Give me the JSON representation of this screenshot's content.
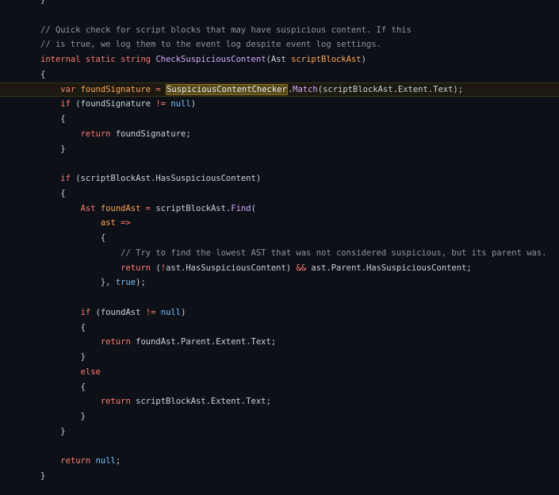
{
  "editor": {
    "lines": [
      [
        {
          "t": "}",
          "k": "plain"
        }
      ],
      [],
      [
        {
          "t": "// Quick check for script blocks that may have suspicious content. If this",
          "k": "cmt"
        }
      ],
      [
        {
          "t": "// is true, we log them to the event log despite event log settings.",
          "k": "cmt"
        }
      ],
      [
        {
          "t": "internal",
          "k": "kw"
        },
        {
          "t": " ",
          "k": "plain"
        },
        {
          "t": "static",
          "k": "kw"
        },
        {
          "t": " ",
          "k": "plain"
        },
        {
          "t": "string",
          "k": "kw"
        },
        {
          "t": " ",
          "k": "plain"
        },
        {
          "t": "CheckSuspiciousContent",
          "k": "fn"
        },
        {
          "t": "(Ast ",
          "k": "plain"
        },
        {
          "t": "scriptBlockAst",
          "k": "var"
        },
        {
          "t": ")",
          "k": "plain"
        }
      ],
      [
        {
          "t": "{",
          "k": "plain"
        }
      ],
      [
        {
          "t": "    ",
          "k": "plain"
        },
        {
          "t": "var",
          "k": "kw"
        },
        {
          "t": " ",
          "k": "plain"
        },
        {
          "t": "foundSignature",
          "k": "var"
        },
        {
          "t": " ",
          "k": "plain"
        },
        {
          "t": "=",
          "k": "op"
        },
        {
          "t": " ",
          "k": "plain"
        },
        {
          "t": "SuspiciousContentChecker",
          "k": "mark"
        },
        {
          "t": ".",
          "k": "plain"
        },
        {
          "t": "Match",
          "k": "fn"
        },
        {
          "t": "(scriptBlockAst.Extent.Text);",
          "k": "plain"
        }
      ],
      [
        {
          "t": "    ",
          "k": "plain"
        },
        {
          "t": "if",
          "k": "kw"
        },
        {
          "t": " (foundSignature ",
          "k": "plain"
        },
        {
          "t": "!=",
          "k": "op"
        },
        {
          "t": " ",
          "k": "plain"
        },
        {
          "t": "null",
          "k": "const"
        },
        {
          "t": ")",
          "k": "plain"
        }
      ],
      [
        {
          "t": "    {",
          "k": "plain"
        }
      ],
      [
        {
          "t": "        ",
          "k": "plain"
        },
        {
          "t": "return",
          "k": "kw"
        },
        {
          "t": " foundSignature;",
          "k": "plain"
        }
      ],
      [
        {
          "t": "    }",
          "k": "plain"
        }
      ],
      [],
      [
        {
          "t": "    ",
          "k": "plain"
        },
        {
          "t": "if",
          "k": "kw"
        },
        {
          "t": " (scriptBlockAst.HasSuspiciousContent)",
          "k": "plain"
        }
      ],
      [
        {
          "t": "    {",
          "k": "plain"
        }
      ],
      [
        {
          "t": "        ",
          "k": "plain"
        },
        {
          "t": "Ast",
          "k": "kw"
        },
        {
          "t": " ",
          "k": "plain"
        },
        {
          "t": "foundAst",
          "k": "var"
        },
        {
          "t": " ",
          "k": "plain"
        },
        {
          "t": "=",
          "k": "op"
        },
        {
          "t": " scriptBlockAst.",
          "k": "plain"
        },
        {
          "t": "Find",
          "k": "fn"
        },
        {
          "t": "(",
          "k": "plain"
        }
      ],
      [
        {
          "t": "            ",
          "k": "plain"
        },
        {
          "t": "ast",
          "k": "var"
        },
        {
          "t": " ",
          "k": "plain"
        },
        {
          "t": "=>",
          "k": "op"
        }
      ],
      [
        {
          "t": "            {",
          "k": "plain"
        }
      ],
      [
        {
          "t": "                ",
          "k": "plain"
        },
        {
          "t": "// Try to find the lowest AST that was not considered suspicious, but its parent was.",
          "k": "cmt"
        }
      ],
      [
        {
          "t": "                ",
          "k": "plain"
        },
        {
          "t": "return",
          "k": "kw"
        },
        {
          "t": " (",
          "k": "plain"
        },
        {
          "t": "!",
          "k": "op"
        },
        {
          "t": "ast.HasSuspiciousContent) ",
          "k": "plain"
        },
        {
          "t": "&&",
          "k": "op"
        },
        {
          "t": " ast.Parent.HasSuspiciousContent;",
          "k": "plain"
        }
      ],
      [
        {
          "t": "            }, ",
          "k": "plain"
        },
        {
          "t": "true",
          "k": "const"
        },
        {
          "t": ");",
          "k": "plain"
        }
      ],
      [],
      [
        {
          "t": "        ",
          "k": "plain"
        },
        {
          "t": "if",
          "k": "kw"
        },
        {
          "t": " (foundAst ",
          "k": "plain"
        },
        {
          "t": "!=",
          "k": "op"
        },
        {
          "t": " ",
          "k": "plain"
        },
        {
          "t": "null",
          "k": "const"
        },
        {
          "t": ")",
          "k": "plain"
        }
      ],
      [
        {
          "t": "        {",
          "k": "plain"
        }
      ],
      [
        {
          "t": "            ",
          "k": "plain"
        },
        {
          "t": "return",
          "k": "kw"
        },
        {
          "t": " foundAst.Parent.Extent.Text;",
          "k": "plain"
        }
      ],
      [
        {
          "t": "        }",
          "k": "plain"
        }
      ],
      [
        {
          "t": "        ",
          "k": "plain"
        },
        {
          "t": "else",
          "k": "kw"
        }
      ],
      [
        {
          "t": "        {",
          "k": "plain"
        }
      ],
      [
        {
          "t": "            ",
          "k": "plain"
        },
        {
          "t": "return",
          "k": "kw"
        },
        {
          "t": " scriptBlockAst.Extent.Text;",
          "k": "plain"
        }
      ],
      [
        {
          "t": "        }",
          "k": "plain"
        }
      ],
      [
        {
          "t": "    }",
          "k": "plain"
        }
      ],
      [],
      [
        {
          "t": "    ",
          "k": "plain"
        },
        {
          "t": "return",
          "k": "kw"
        },
        {
          "t": " ",
          "k": "plain"
        },
        {
          "t": "null",
          "k": "const"
        },
        {
          "t": ";",
          "k": "plain"
        }
      ],
      [
        {
          "t": "}",
          "k": "plain"
        }
      ]
    ],
    "highlighted_line": 6,
    "colors": {
      "background": "#0d1117",
      "keyword": "#ff7b72",
      "function": "#d2a8ff",
      "variable": "#ffa657",
      "comment": "#8b949e",
      "constant": "#79c0ff",
      "text": "#c9d1d9",
      "highlight_line": "#1c1a10",
      "match_highlight": "#5a4a1a"
    }
  }
}
